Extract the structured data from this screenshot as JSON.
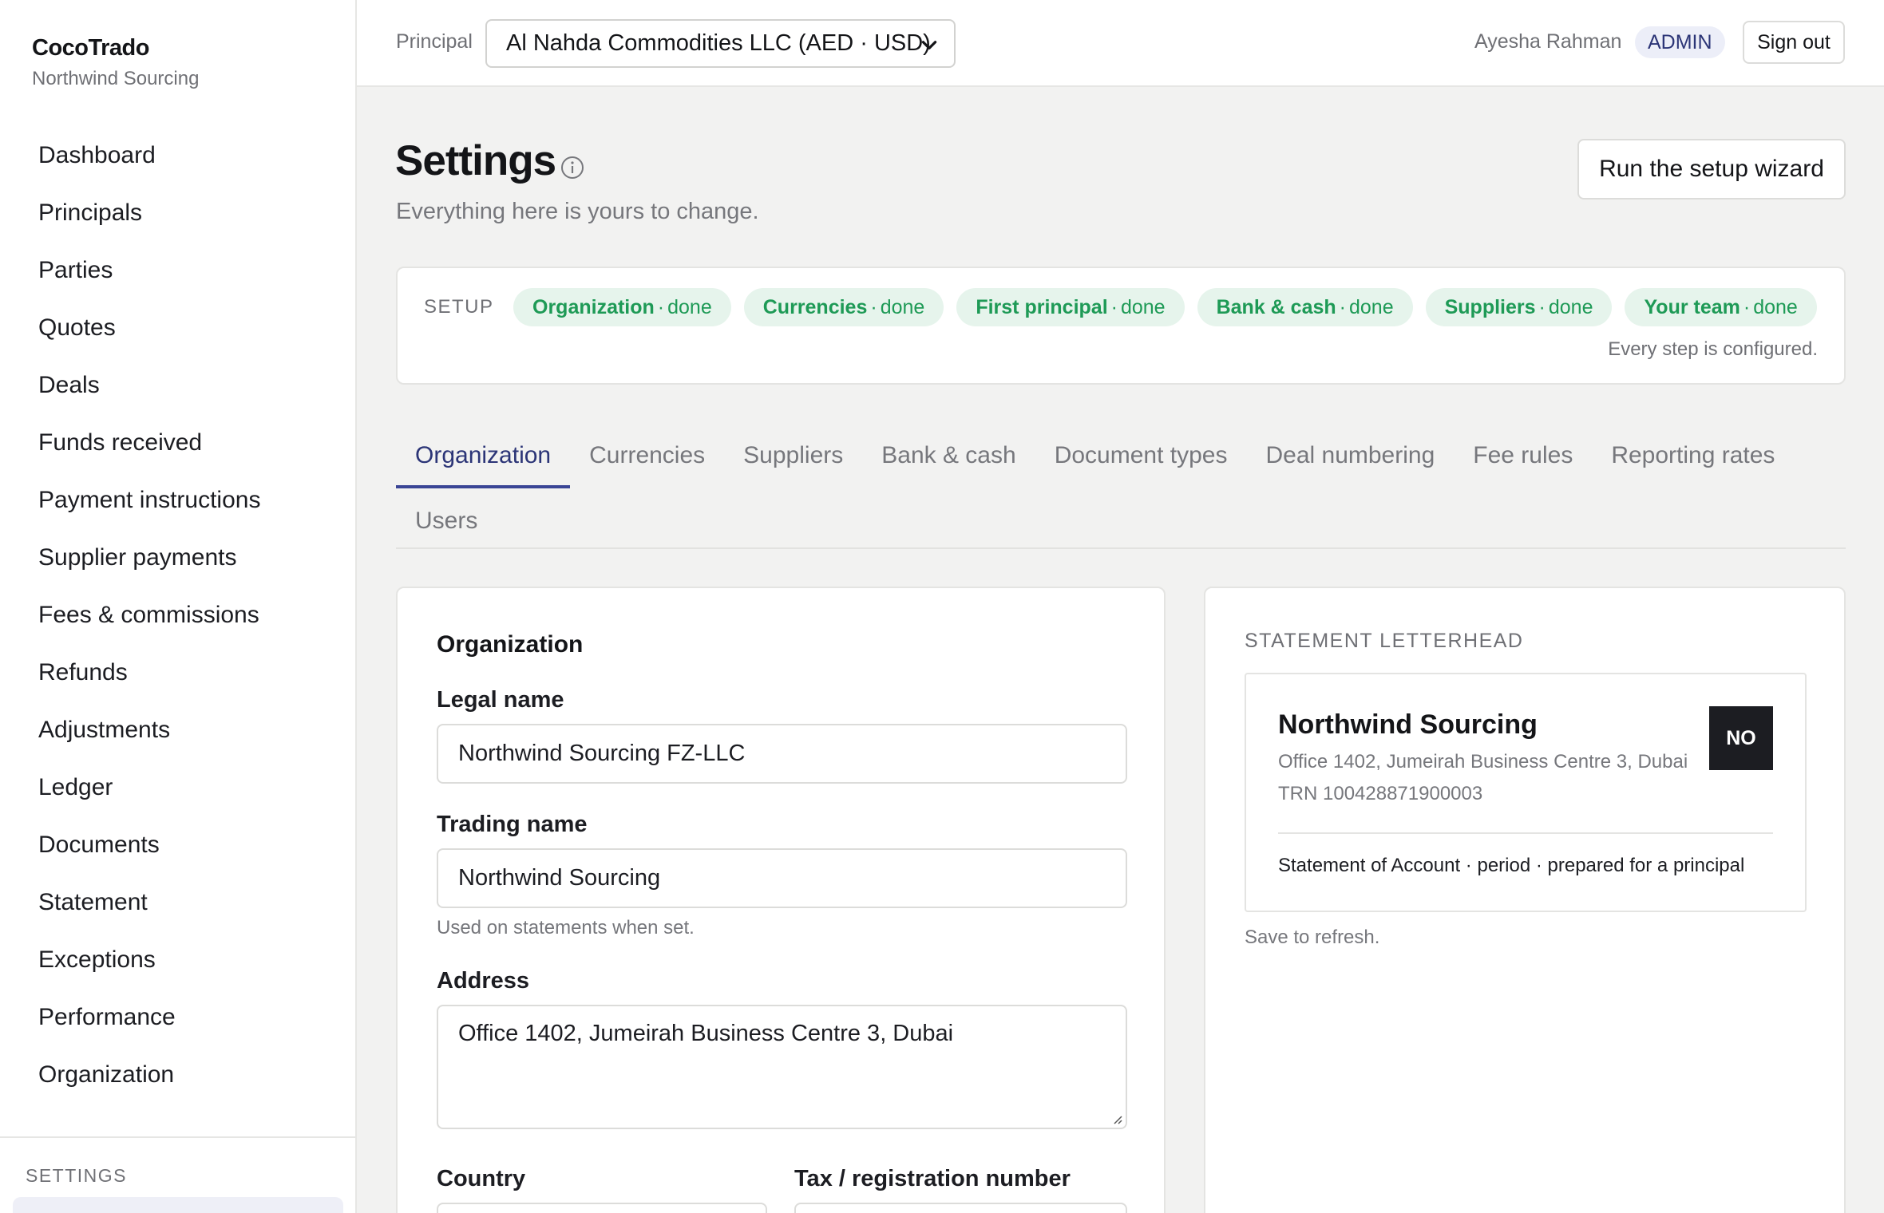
{
  "brand": {
    "name": "CocoTrado",
    "workspace": "Northwind Sourcing"
  },
  "sidebar": {
    "items": [
      {
        "label": "Dashboard"
      },
      {
        "label": "Principals"
      },
      {
        "label": "Parties"
      },
      {
        "label": "Quotes"
      },
      {
        "label": "Deals"
      },
      {
        "label": "Funds received"
      },
      {
        "label": "Payment instructions"
      },
      {
        "label": "Supplier payments"
      },
      {
        "label": "Fees & commissions"
      },
      {
        "label": "Refunds"
      },
      {
        "label": "Adjustments"
      },
      {
        "label": "Ledger"
      },
      {
        "label": "Documents"
      },
      {
        "label": "Statement"
      },
      {
        "label": "Exceptions"
      },
      {
        "label": "Performance"
      },
      {
        "label": "Organization"
      }
    ],
    "section_label": "SETTINGS"
  },
  "topbar": {
    "principal_label": "Principal",
    "principal_value": "Al Nahda Commodities LLC (AED · USD)",
    "user_name": "Ayesha Rahman",
    "role": "ADMIN",
    "signout_label": "Sign out"
  },
  "header": {
    "title": "Settings",
    "subtitle": "Everything here is yours to change.",
    "wizard_label": "Run the setup wizard"
  },
  "setup": {
    "label": "SETUP",
    "steps": [
      {
        "name": "Organization",
        "status": "done"
      },
      {
        "name": "Currencies",
        "status": "done"
      },
      {
        "name": "First principal",
        "status": "done"
      },
      {
        "name": "Bank & cash",
        "status": "done"
      },
      {
        "name": "Suppliers",
        "status": "done"
      },
      {
        "name": "Your team",
        "status": "done"
      }
    ],
    "note": "Every step is configured."
  },
  "tabs": [
    {
      "label": "Organization",
      "active": true
    },
    {
      "label": "Currencies"
    },
    {
      "label": "Suppliers"
    },
    {
      "label": "Bank & cash"
    },
    {
      "label": "Document types"
    },
    {
      "label": "Deal numbering"
    },
    {
      "label": "Fee rules"
    },
    {
      "label": "Reporting rates"
    },
    {
      "label": "Users"
    }
  ],
  "org_form": {
    "title": "Organization",
    "legal_name_label": "Legal name",
    "legal_name_value": "Northwind Sourcing FZ-LLC",
    "trading_name_label": "Trading name",
    "trading_name_value": "Northwind Sourcing",
    "trading_name_hint": "Used on statements when set.",
    "address_label": "Address",
    "address_value": "Office 1402, Jumeirah Business Centre 3, Dubai",
    "country_label": "Country",
    "tax_label": "Tax / registration number"
  },
  "letterhead": {
    "label": "STATEMENT LETTERHEAD",
    "name": "Northwind Sourcing",
    "address": "Office 1402, Jumeirah Business Centre 3, Dubai",
    "trn": "TRN 100428871900003",
    "logo_text": "NO",
    "caption": "Statement of Account · period · prepared for a principal",
    "note": "Save to refresh."
  },
  "colors": {
    "accent": "#3a4595",
    "success_text": "#1e9a56",
    "success_bg": "#e6f4ec"
  }
}
